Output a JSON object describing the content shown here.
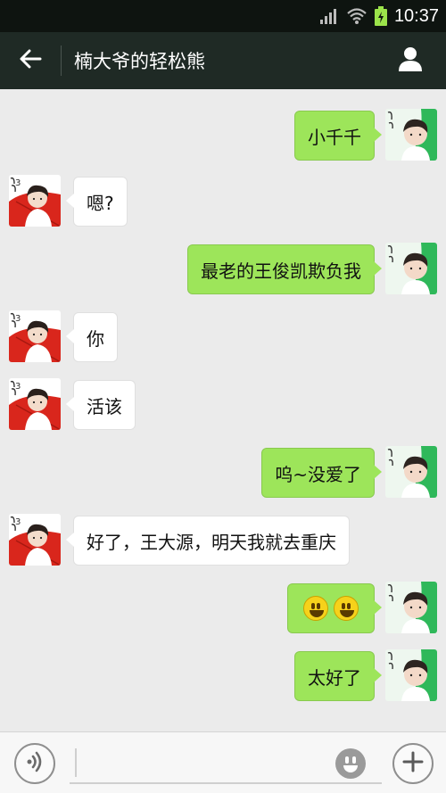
{
  "status_bar": {
    "time": "10:37",
    "icons": [
      "signal-icon",
      "wifi-icon",
      "battery-icon"
    ]
  },
  "header": {
    "title": "楠大爷的轻松熊",
    "back_icon": "arrow-left-icon",
    "contact_icon": "person-icon"
  },
  "messages": [
    {
      "side": "self",
      "text": "小千千"
    },
    {
      "side": "other",
      "text": "嗯?"
    },
    {
      "side": "self",
      "text": "最老的王俊凯欺负我"
    },
    {
      "side": "other",
      "text": "你"
    },
    {
      "side": "other",
      "text": "活该"
    },
    {
      "side": "self",
      "text": "呜~没爱了"
    },
    {
      "side": "other",
      "text": "好了，王大源，明天我就去重庆"
    },
    {
      "side": "self",
      "text": "",
      "emojis": [
        "grinning-face-emoji",
        "grinning-face-emoji"
      ]
    },
    {
      "side": "self",
      "text": "太好了"
    }
  ],
  "input_bar": {
    "voice_icon": "voice-icon",
    "emoji_icon": "smiley-icon",
    "plus_icon": "plus-icon",
    "value": ""
  },
  "colors": {
    "self_bubble": "#9de55a",
    "other_bubble": "#ffffff",
    "header_bg": "#1f2a25",
    "chat_bg": "#ebebeb"
  }
}
